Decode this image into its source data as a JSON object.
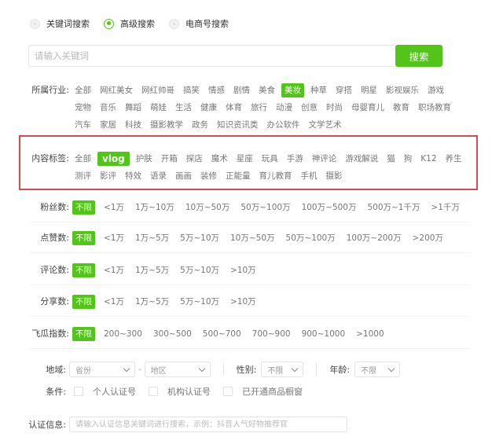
{
  "search_modes": [
    {
      "label": "关键词搜索",
      "checked": false
    },
    {
      "label": "高级搜索",
      "checked": true
    },
    {
      "label": "电商号搜索",
      "checked": false
    }
  ],
  "search": {
    "placeholder": "请输入关键词",
    "value": "",
    "button_label": "搜索"
  },
  "industry": {
    "label": "所属行业:",
    "selected": "美妆",
    "options": [
      "全部",
      "网红美女",
      "网红帅哥",
      "搞笑",
      "情感",
      "剧情",
      "美食",
      "美妆",
      "种草",
      "穿搭",
      "明星",
      "影视娱乐",
      "游戏",
      "宠物",
      "音乐",
      "舞蹈",
      "萌娃",
      "生活",
      "健康",
      "体育",
      "旅行",
      "动漫",
      "创意",
      "时尚",
      "母婴育儿",
      "教育",
      "职场教育",
      "汽车",
      "家居",
      "科技",
      "摄影教学",
      "政务",
      "知识资讯类",
      "办公软件",
      "文学艺术"
    ]
  },
  "content_tags": {
    "label": "内容标签:",
    "selected": "vlog",
    "highlight_color": "#d94a55",
    "options": [
      "全部",
      "vlog",
      "护肤",
      "开箱",
      "探店",
      "魔术",
      "星座",
      "玩具",
      "手游",
      "神评论",
      "游戏解说",
      "猫",
      "狗",
      "K12",
      "养生",
      "测评",
      "影评",
      "特效",
      "语录",
      "画画",
      "装修",
      "正能量",
      "育儿教育",
      "手机",
      "摄影"
    ]
  },
  "numeric_filters": [
    {
      "label": "粉丝数:",
      "selected": "不限",
      "options": [
        "不限",
        "<1万",
        "1万~10万",
        "10万~50万",
        "50万~100万",
        "100万~500万",
        "500万~1千万",
        ">1千万"
      ]
    },
    {
      "label": "点赞数:",
      "selected": "不限",
      "options": [
        "不限",
        "<1万",
        "1万~5万",
        "5万~10万",
        "10万~50万",
        "50万~100万",
        "100万~200万",
        ">200万"
      ]
    },
    {
      "label": "评论数:",
      "selected": "不限",
      "options": [
        "不限",
        "<1万",
        "1万~5万",
        "5万~10万",
        ">10万"
      ]
    },
    {
      "label": "分享数:",
      "selected": "不限",
      "options": [
        "不限",
        "<1万",
        "1万~5万",
        "5万~10万",
        ">10万"
      ]
    },
    {
      "label": "飞瓜指数:",
      "selected": "不限",
      "options": [
        "不限",
        "200~300",
        "300~500",
        "500~700",
        "700~900",
        "900~1000",
        ">1000"
      ]
    }
  ],
  "region": {
    "label": "地域:",
    "province": "省份",
    "separator": "-",
    "district": "地区",
    "gender_label": "性别:",
    "gender": "不限",
    "age_label": "年龄:",
    "age": "不限"
  },
  "conditions": {
    "label": "条件:",
    "options": [
      {
        "label": "个人认证号",
        "checked": false
      },
      {
        "label": "机构认证号",
        "checked": false
      },
      {
        "label": "已开通商品橱窗",
        "checked": false
      }
    ]
  },
  "certification": {
    "label": "认证信息:",
    "placeholder": "请输入认证信息关键词进行搜索，示例：抖音人气好物推荐官",
    "value": ""
  },
  "colors": {
    "accent": "#52c41a",
    "highlight": "#d94a55"
  }
}
